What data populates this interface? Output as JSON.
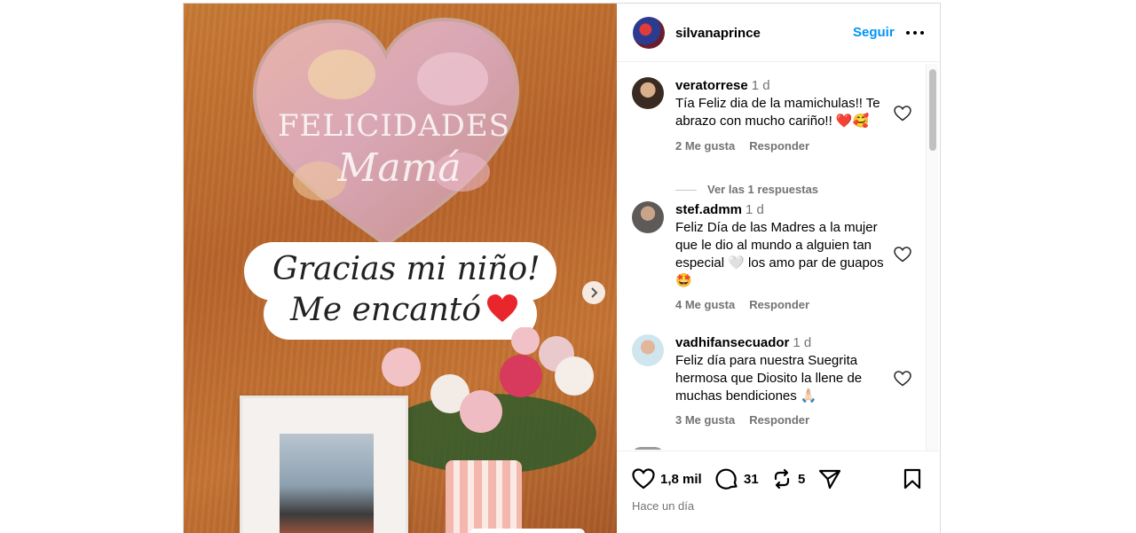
{
  "post": {
    "media": {
      "balloon_line1": "FELICIDADES",
      "balloon_line2": "Mamá",
      "caption_line1": "Gracias mi niño!",
      "caption_line2": "Me encantó",
      "caption_emoji": "red-heart"
    },
    "header": {
      "username": "silvanaprince",
      "follow_label": "Seguir",
      "more_icon": "more-horizontal-icon"
    },
    "comments": [
      {
        "username": "veratorrese",
        "time": "1 d",
        "text": "Tía Feliz dia de la mamichulas!! Te abrazo con mucho cariño!! ❤️🥰",
        "likes": "2 Me gusta",
        "reply": "Responder",
        "view_replies": "Ver las 1 respuestas"
      },
      {
        "username": "stef.admm",
        "time": "1 d",
        "text": "Feliz Día de las Madres a la mujer que le dio al mundo a alguien tan especial 🤍 los amo par de guapos 🤩",
        "likes": "4 Me gusta",
        "reply": "Responder"
      },
      {
        "username": "vadhifansecuador",
        "time": "1 d",
        "text": "Feliz día para nuestra Suegrita hermosa que Diosito la llene de muchas bendiciones 🙏🏻",
        "likes": "3 Me gusta",
        "reply": "Responder"
      }
    ],
    "actions": {
      "like_count": "1,8 mil",
      "comment_count": "31",
      "repost_count": "5"
    },
    "time_ago": "Hace un día"
  },
  "colors": {
    "accent": "#0095f6",
    "muted_text": "#737373",
    "border": "#dbdbdb"
  }
}
